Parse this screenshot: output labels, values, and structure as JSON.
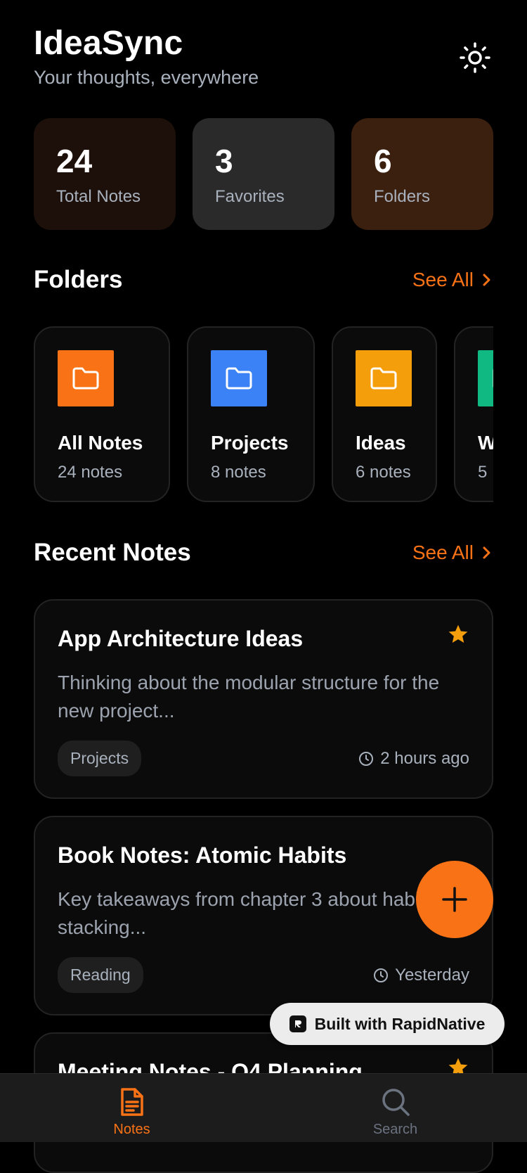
{
  "header": {
    "title": "IdeaSync",
    "subtitle": "Your thoughts, everywhere",
    "theme_icon": "sun-icon"
  },
  "stats": [
    {
      "value": "24",
      "label": "Total Notes"
    },
    {
      "value": "3",
      "label": "Favorites"
    },
    {
      "value": "6",
      "label": "Folders"
    }
  ],
  "folders_section": {
    "title": "Folders",
    "see_all": "See All",
    "items": [
      {
        "name": "All Notes",
        "count": "24 notes",
        "color": "#f97316"
      },
      {
        "name": "Projects",
        "count": "8 notes",
        "color": "#3b82f6"
      },
      {
        "name": "Ideas",
        "count": "6 notes",
        "color": "#f59e0b"
      },
      {
        "name": "W",
        "count": "5",
        "color": "#10b981"
      }
    ]
  },
  "recent_section": {
    "title": "Recent Notes",
    "see_all": "See All",
    "notes": [
      {
        "title": "App Architecture Ideas",
        "preview": "Thinking about the modular structure for the new project...",
        "tag": "Projects",
        "time": "2 hours ago",
        "favorite": true
      },
      {
        "title": "Book Notes: Atomic Habits",
        "preview": "Key takeaways from chapter 3 about habit stacking...",
        "tag": "Reading",
        "time": "Yesterday",
        "favorite": false
      },
      {
        "title": "Meeting Notes - Q4 Planning",
        "favorite": true
      }
    ]
  },
  "badge": {
    "label": "Built with RapidNative"
  },
  "tabs": [
    {
      "label": "Notes",
      "icon": "note-icon",
      "active": true
    },
    {
      "label": "Search",
      "icon": "search-icon",
      "active": false
    }
  ],
  "colors": {
    "accent": "#f97316",
    "star": "#f59e0b"
  }
}
